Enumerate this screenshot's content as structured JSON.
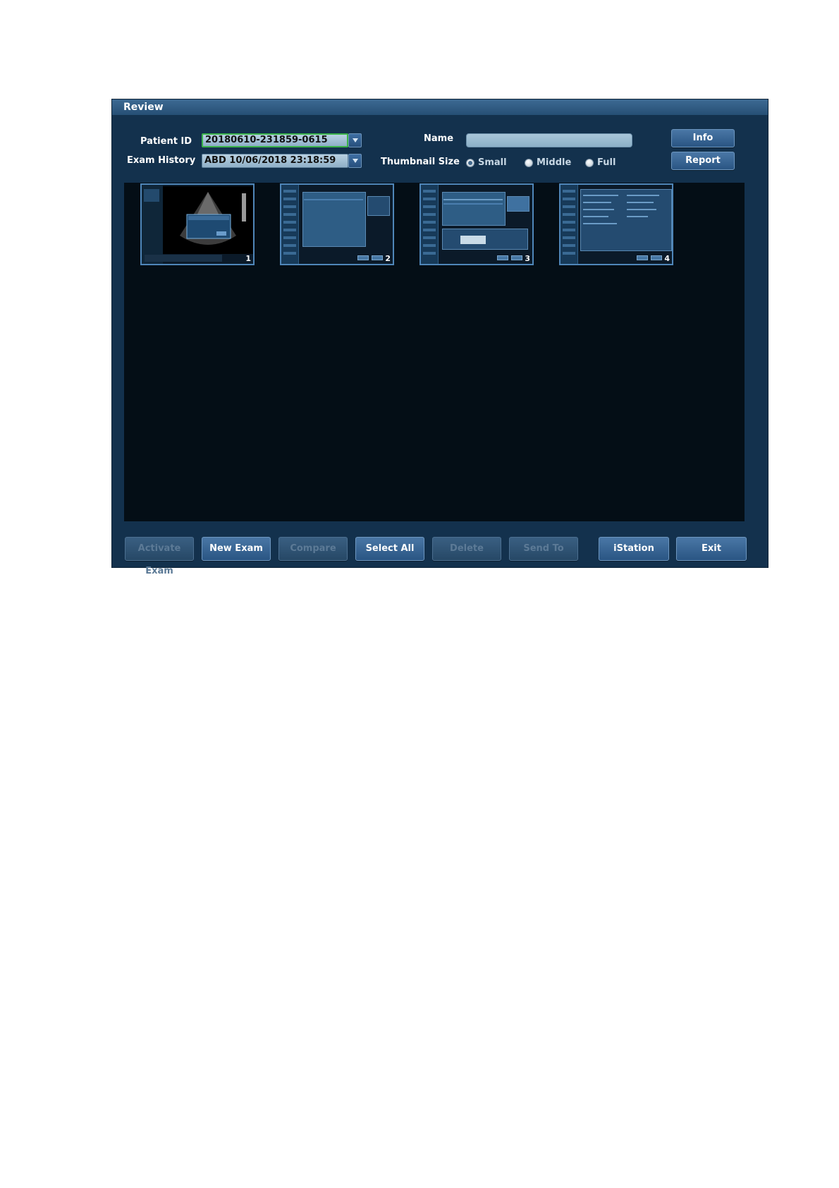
{
  "window": {
    "title": "Review"
  },
  "header": {
    "patient_id_label": "Patient ID",
    "patient_id_value": "20180610-231859-0615",
    "exam_history_label": "Exam History",
    "exam_history_value": "ABD 10/06/2018 23:18:59",
    "name_label": "Name",
    "name_value": "",
    "thumbnail_size_label": "Thumbnail Size",
    "thumbnail_options": [
      {
        "label": "Small",
        "selected": true
      },
      {
        "label": "Middle",
        "selected": false
      },
      {
        "label": "Full",
        "selected": false
      }
    ],
    "info_button": "Info",
    "report_button": "Report"
  },
  "thumbnails": [
    {
      "number": "1"
    },
    {
      "number": "2"
    },
    {
      "number": "3"
    },
    {
      "number": "4"
    }
  ],
  "footer_buttons": [
    {
      "label": "Activate Exam",
      "enabled": false
    },
    {
      "label": "New Exam",
      "enabled": true
    },
    {
      "label": "Compare",
      "enabled": false
    },
    {
      "label": "Select All",
      "enabled": true
    },
    {
      "label": "Delete",
      "enabled": false
    },
    {
      "label": "Send To",
      "enabled": false
    },
    {
      "label": "iStation",
      "enabled": true
    },
    {
      "label": "Exit",
      "enabled": true
    }
  ],
  "colors": {
    "window_bg": "#13314d",
    "accent": "#4a77a6",
    "viewer_bg": "#040e16",
    "focus": "#3bb34a"
  },
  "icons": {
    "dropdown": "triangle-down-icon"
  }
}
